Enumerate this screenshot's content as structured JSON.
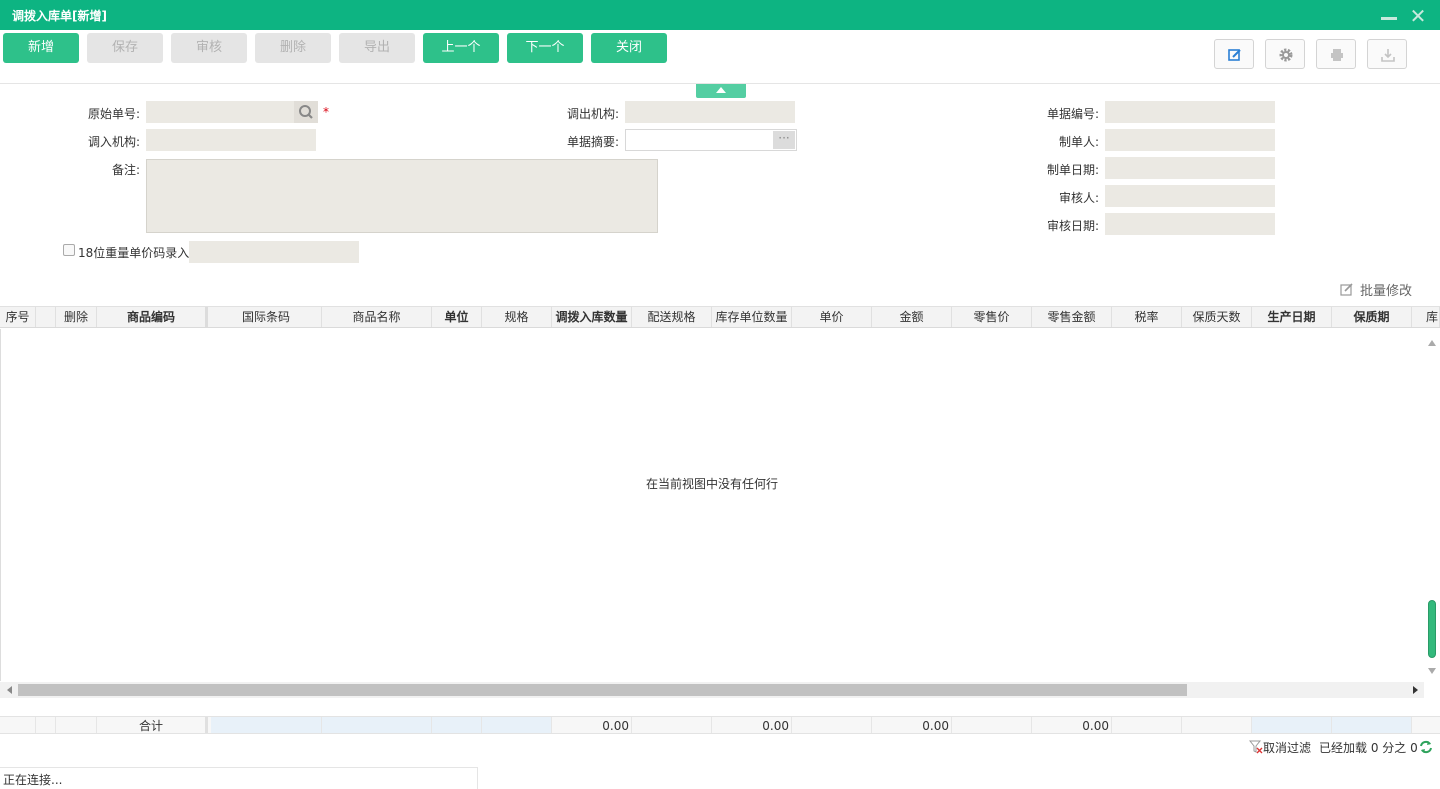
{
  "window": {
    "title": "调拨入库单[新增]",
    "accent_color": "#0db482"
  },
  "toolbar": {
    "buttons": [
      {
        "label": "新增",
        "enabled": true
      },
      {
        "label": "保存",
        "enabled": false
      },
      {
        "label": "审核",
        "enabled": false
      },
      {
        "label": "删除",
        "enabled": false
      },
      {
        "label": "导出",
        "enabled": false
      },
      {
        "label": "上一个",
        "enabled": true
      },
      {
        "label": "下一个",
        "enabled": true
      },
      {
        "label": "关闭",
        "enabled": true
      }
    ],
    "icons": [
      "edit-icon",
      "gear-icon",
      "print-icon",
      "download-icon"
    ]
  },
  "form": {
    "orig_no_label": "原始单号:",
    "out_org_label": "调出机构:",
    "doc_no_label": "单据编号:",
    "in_org_label": "调入机构:",
    "summary_label": "单据摘要:",
    "creator_label": "制单人:",
    "remark_label": "备注:",
    "create_date_label": "制单日期:",
    "auditor_label": "审核人:",
    "audit_date_label": "审核日期:",
    "barcode18_label": "18位重量单价码录入",
    "required_mark": "*",
    "ellipsis": "···"
  },
  "grid": {
    "batch_edit_label": "批量修改",
    "columns": [
      "序号",
      "删除",
      "商品编码",
      "国际条码",
      "商品名称",
      "单位",
      "规格",
      "调拨入库数量",
      "配送规格",
      "库存单位数量",
      "单价",
      "金额",
      "零售价",
      "零售金额",
      "税率",
      "保质天数",
      "生产日期",
      "保质期",
      "库"
    ],
    "empty_text": "在当前视图中没有任何行",
    "footer": {
      "total_label": "合计",
      "qty_total": "0.00",
      "stock_qty_total": "0.00",
      "amount_total": "0.00",
      "retail_amount_total": "0.00"
    }
  },
  "status_bar": {
    "cancel_filter": "取消过滤",
    "loaded": "已经加载 0 分之 0",
    "connecting": "正在连接..."
  }
}
